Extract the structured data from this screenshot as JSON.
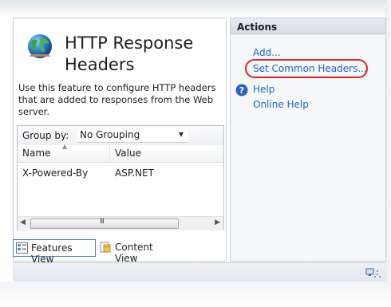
{
  "feature": {
    "title": "HTTP Response Headers",
    "icon": "globe-icon",
    "description": "Use this feature to configure HTTP headers that are added to responses from the Web server."
  },
  "list": {
    "group_by_label": "Group by:",
    "group_by_value": "No Grouping",
    "columns": [
      "Name",
      "Value"
    ],
    "rows": [
      {
        "name": "X-Powered-By",
        "value": "ASP.NET"
      }
    ],
    "scroll_grip": "III"
  },
  "views": {
    "features": "Features View",
    "content": "Content View"
  },
  "actions": {
    "header": "Actions",
    "add": "Add...",
    "set_common": "Set Common Headers...",
    "help": "Help",
    "online_help": "Online Help"
  },
  "colors": {
    "link": "#1a64c4",
    "highlight": "#e0251e",
    "selected_tab_border": "#3f7fcf"
  }
}
